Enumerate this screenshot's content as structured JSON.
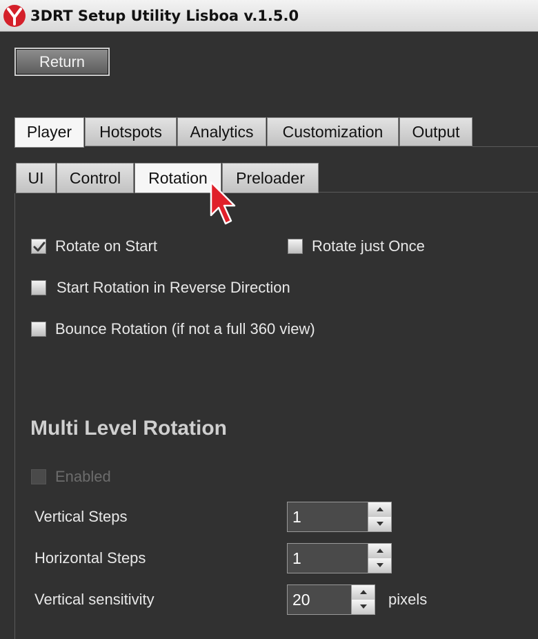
{
  "window": {
    "title": "3DRT Setup Utility Lisboa v.1.5.0",
    "logo_icon": "3drt-logo-icon"
  },
  "return_button": {
    "label": "Return"
  },
  "main_tabs": [
    {
      "label": "Player",
      "active": true
    },
    {
      "label": "Hotspots",
      "active": false
    },
    {
      "label": "Analytics",
      "active": false
    },
    {
      "label": "Customization",
      "active": false
    },
    {
      "label": "Output",
      "active": false
    }
  ],
  "sub_tabs": [
    {
      "label": "UI",
      "active": false
    },
    {
      "label": "Control",
      "active": false
    },
    {
      "label": "Rotation",
      "active": true
    },
    {
      "label": "Preloader",
      "active": false
    }
  ],
  "options": {
    "rotate_on_start": {
      "label": "Rotate on Start",
      "checked": true
    },
    "rotate_just_once": {
      "label": "Rotate just Once",
      "checked": false
    },
    "reverse_direction": {
      "label": "Start Rotation in Reverse Direction",
      "checked": false
    },
    "bounce_rotation": {
      "label": "Bounce Rotation (if not a full 360 view)",
      "checked": false
    }
  },
  "multi_level": {
    "title": "Multi Level Rotation",
    "enabled": {
      "label": "Enabled",
      "checked": false,
      "disabled": true
    },
    "vertical_steps": {
      "label": "Vertical Steps",
      "value": "1"
    },
    "horizontal_steps": {
      "label": "Horizontal Steps",
      "value": "1"
    },
    "vertical_sensitivity": {
      "label": "Vertical sensitivity",
      "value": "20",
      "unit": "pixels"
    }
  },
  "colors": {
    "background": "#313131",
    "accent_red": "#e0202a"
  }
}
